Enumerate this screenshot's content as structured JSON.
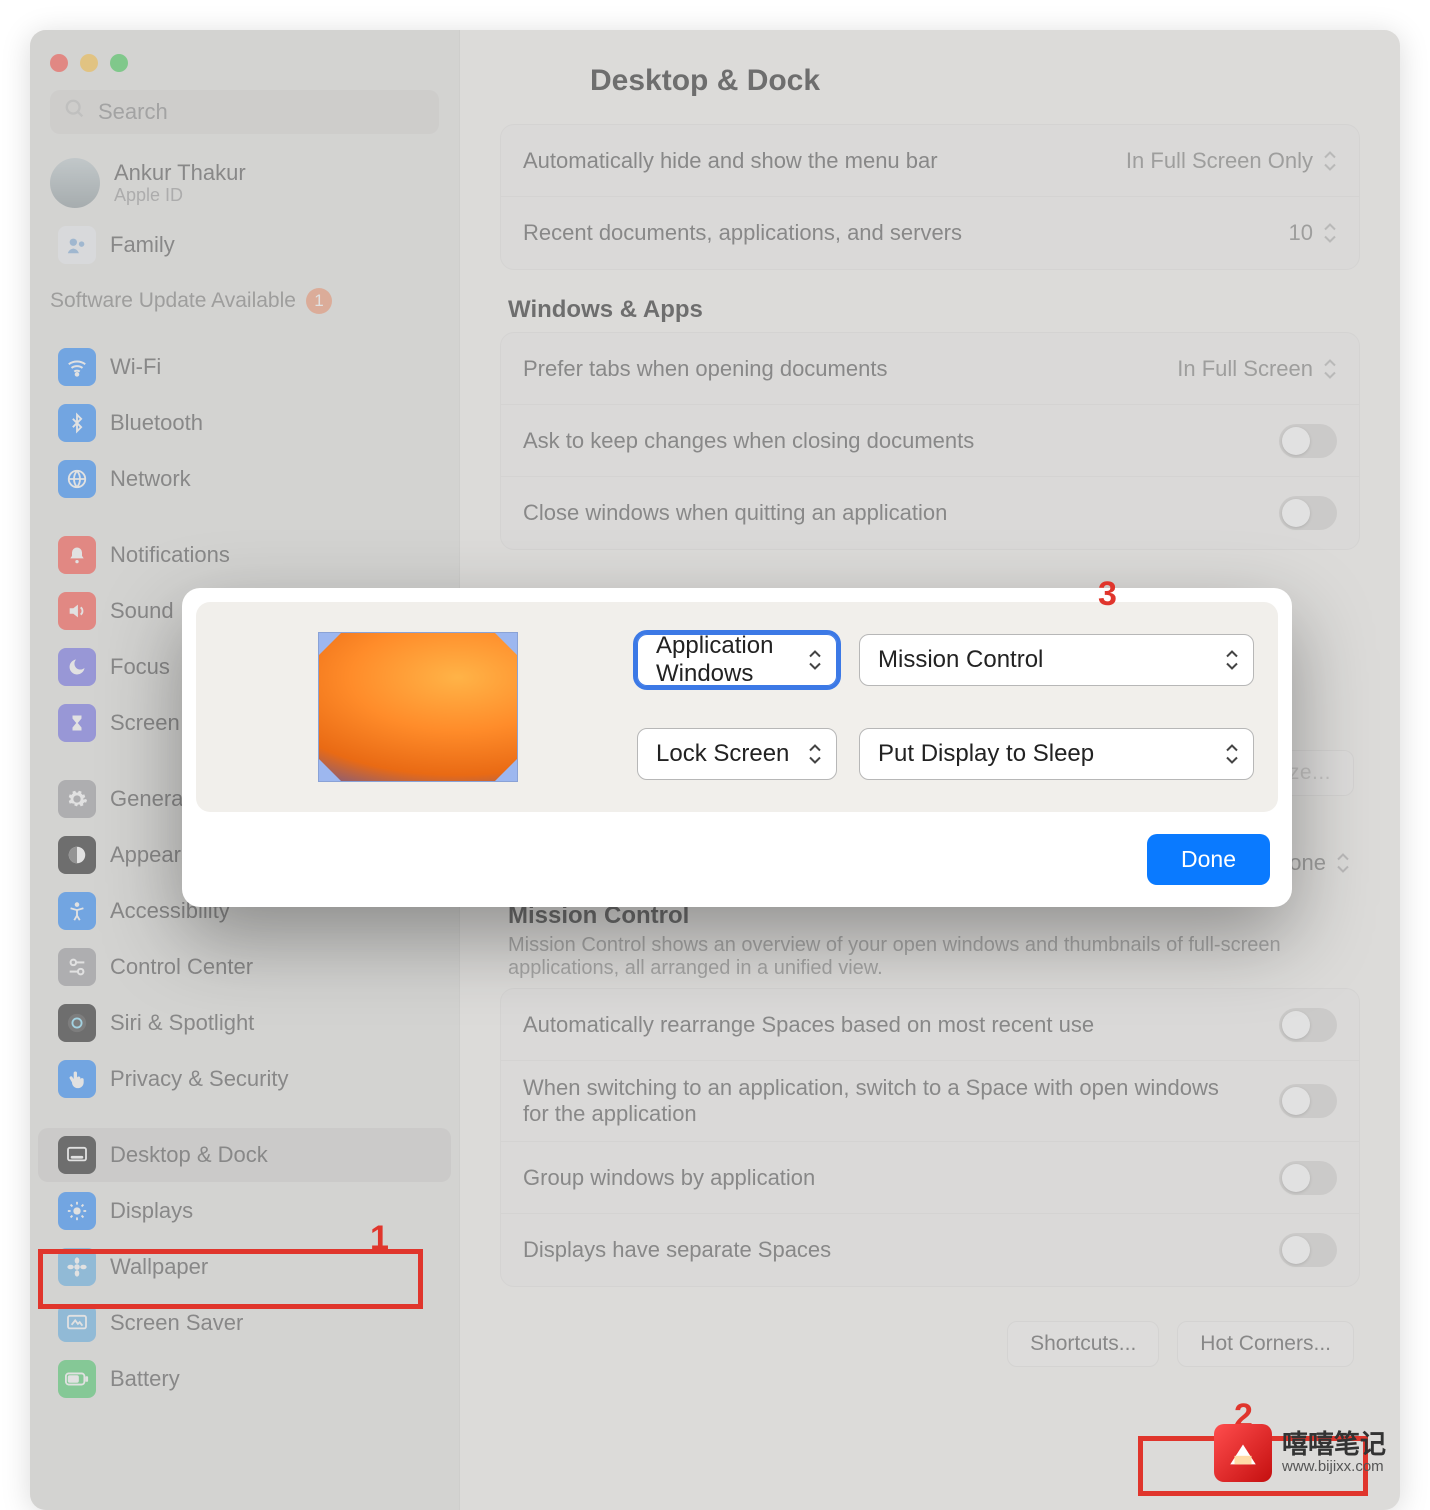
{
  "window": {
    "title": "Desktop & Dock"
  },
  "user": {
    "name": "Ankur Thakur",
    "sub": "Apple ID"
  },
  "sidebar": {
    "search_placeholder": "Search",
    "family": "Family",
    "update_note": "Software Update Available",
    "update_badge": "1",
    "items": [
      {
        "label": "Wi-Fi",
        "icon": "wifi",
        "bg": "bg-blue"
      },
      {
        "label": "Bluetooth",
        "icon": "bluetooth",
        "bg": "bg-blue"
      },
      {
        "label": "Network",
        "icon": "globe",
        "bg": "bg-blue"
      }
    ],
    "items2": [
      {
        "label": "Notifications",
        "icon": "bell",
        "bg": "bg-red"
      },
      {
        "label": "Sound",
        "icon": "speaker",
        "bg": "bg-red"
      },
      {
        "label": "Focus",
        "icon": "moon",
        "bg": "bg-indigo"
      },
      {
        "label": "Screen Time",
        "icon": "hourglass",
        "bg": "bg-indigo"
      }
    ],
    "items3": [
      {
        "label": "General",
        "icon": "gear",
        "bg": "bg-gray"
      },
      {
        "label": "Appearance",
        "icon": "appearance",
        "bg": "bg-dark"
      },
      {
        "label": "Accessibility",
        "icon": "access",
        "bg": "bg-blue"
      },
      {
        "label": "Control Center",
        "icon": "switches",
        "bg": "bg-gray"
      },
      {
        "label": "Siri & Spotlight",
        "icon": "siri",
        "bg": "bg-dark"
      },
      {
        "label": "Privacy & Security",
        "icon": "hand",
        "bg": "bg-blue"
      }
    ],
    "items4": [
      {
        "label": "Desktop & Dock",
        "icon": "dock",
        "bg": "bg-dark",
        "selected": true
      },
      {
        "label": "Displays",
        "icon": "sun",
        "bg": "bg-blue"
      },
      {
        "label": "Wallpaper",
        "icon": "flower",
        "bg": "bg-sky"
      },
      {
        "label": "Screen Saver",
        "icon": "screensaver",
        "bg": "bg-sky"
      },
      {
        "label": "Battery",
        "icon": "battery",
        "bg": "bg-green"
      }
    ]
  },
  "settings": {
    "menuBar": {
      "label": "Automatically hide and show the menu bar",
      "value": "In Full Screen Only"
    },
    "recent": {
      "label": "Recent documents, applications, and servers",
      "value": "10"
    },
    "winApps": {
      "title": "Windows & Apps"
    },
    "preferTabs": {
      "label": "Prefer tabs when opening documents",
      "value": "In Full Screen"
    },
    "askKeep": {
      "label": "Ask to keep changes when closing documents"
    },
    "closeQuit": {
      "label": "Close windows when quitting an application"
    },
    "customize": {
      "label": "Customize..."
    },
    "defaultBrowser": {
      "value": "None"
    },
    "mc": {
      "title": "Mission Control",
      "desc": "Mission Control shows an overview of your open windows and thumbnails of full-screen applications, all arranged in a unified view."
    },
    "mcRows": {
      "auto": "Automatically rearrange Spaces based on most recent use",
      "switch": "When switching to an application, switch to a Space with open windows for the application",
      "group": "Group windows by application",
      "sep": "Displays have separate Spaces"
    },
    "buttons": {
      "shortcuts": "Shortcuts...",
      "hotCorners": "Hot Corners..."
    }
  },
  "modal": {
    "topLeft": "Application Windows",
    "topRight": "Mission Control",
    "bottomLeft": "Lock Screen",
    "bottomRight": "Put Display to Sleep",
    "done": "Done"
  },
  "annotations": {
    "n1": "1",
    "n2": "2",
    "n3": "3"
  },
  "watermark": {
    "name": "嘻嘻笔记",
    "url": "www.bijixx.com"
  }
}
